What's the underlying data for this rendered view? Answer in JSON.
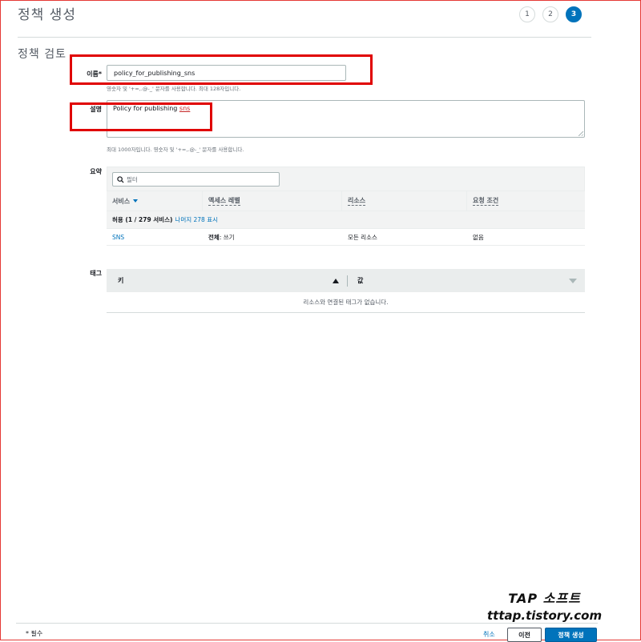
{
  "page_title": "정책 생성",
  "steps": [
    "1",
    "2",
    "3"
  ],
  "section_title": "정책 검토",
  "name_field": {
    "label": "이름*",
    "value": "policy_for_publishing_sns",
    "hint": "영숫자 및 '+=,.@-_' 문자를 사용합니다. 최대 128자입니다."
  },
  "description_field": {
    "label": "설명",
    "value_prefix": "Policy for publishing ",
    "value_suffix": "sns",
    "hint": "최대 1000자입니다. 영숫자 및 '+=,.@-_' 문자를 사용합니다."
  },
  "summary": {
    "label": "요약",
    "filter_placeholder": "필터",
    "columns": [
      "서비스",
      "액세스 레벨",
      "리소스",
      "요청 조건"
    ],
    "group_label": "허용 (1 / 279 서비스)",
    "group_link": "나머지 278 표시",
    "rows": [
      {
        "service": "SNS",
        "access_bold": "전체",
        "access_rest": ": 쓰기",
        "resource": "모든 리소스",
        "condition": "없음"
      }
    ]
  },
  "tags": {
    "label": "태그",
    "key_header": "키",
    "value_header": "값",
    "empty_message": "리소스와 연결된 태그가 없습니다."
  },
  "footer": {
    "required_note": "* 필수",
    "cancel": "취소",
    "previous": "이전",
    "create": "정책 생성"
  },
  "watermark": {
    "line1": "TAP 소프트",
    "line2": "tttap.tistory.com"
  },
  "colors": {
    "accent": "#0073bb",
    "highlight": "#e00000"
  }
}
